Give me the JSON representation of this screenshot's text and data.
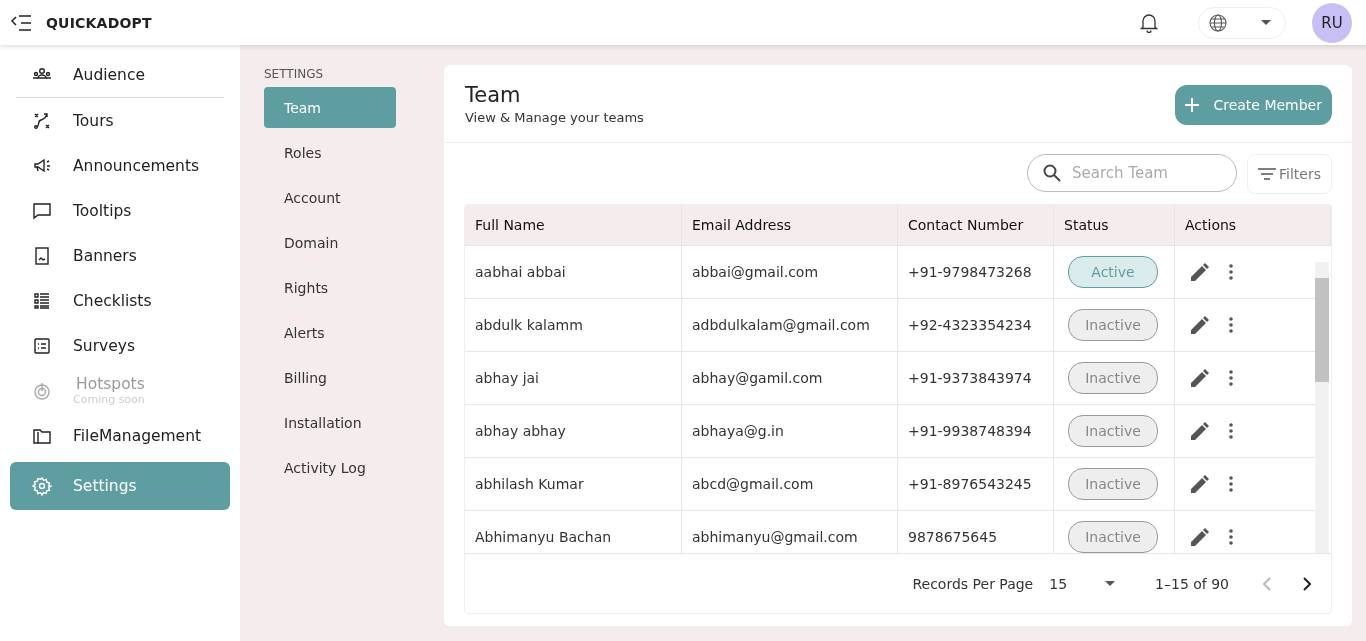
{
  "app": {
    "brand": "QUICKADOPT",
    "avatar": "RU"
  },
  "sidebar": {
    "items": [
      {
        "kind": "audience",
        "label": "Audience",
        "selected": false,
        "disabled": false
      },
      {
        "kind": "tours",
        "label": "Tours",
        "selected": false,
        "disabled": false
      },
      {
        "kind": "announcements",
        "label": "Announcements",
        "selected": false,
        "disabled": false
      },
      {
        "kind": "tooltips",
        "label": "Tooltips",
        "selected": false,
        "disabled": false
      },
      {
        "kind": "banners",
        "label": "Banners",
        "selected": false,
        "disabled": false
      },
      {
        "kind": "checklists",
        "label": "Checklists",
        "selected": false,
        "disabled": false
      },
      {
        "kind": "surveys",
        "label": "Surveys",
        "selected": false,
        "disabled": false
      },
      {
        "kind": "hotspots",
        "label": "Hotspots",
        "note": "Coming soon",
        "selected": false,
        "disabled": true
      },
      {
        "kind": "files",
        "label": "FileManagement",
        "selected": false,
        "disabled": false
      },
      {
        "kind": "settings",
        "label": "Settings",
        "selected": true,
        "disabled": false
      }
    ]
  },
  "settings_nav": {
    "heading": "SETTINGS",
    "items": [
      {
        "label": "Team",
        "selected": true
      },
      {
        "label": "Roles",
        "selected": false
      },
      {
        "label": "Account",
        "selected": false
      },
      {
        "label": "Domain",
        "selected": false
      },
      {
        "label": "Rights",
        "selected": false
      },
      {
        "label": "Alerts",
        "selected": false
      },
      {
        "label": "Billing",
        "selected": false
      },
      {
        "label": "Installation",
        "selected": false
      },
      {
        "label": "Activity Log",
        "selected": false
      }
    ]
  },
  "panel": {
    "title": "Team",
    "subtitle": "View & Manage your teams",
    "create_button": "Create Member",
    "search": {
      "placeholder": "Search Team"
    },
    "filters_button": "Filters"
  },
  "table": {
    "columns": [
      "Full Name",
      "Email Address",
      "Contact Number",
      "Status",
      "Actions"
    ],
    "rows": [
      {
        "name": "aabhai abbai",
        "email": "abbai@gmail.com",
        "contact": "+91-9798473268",
        "status": "Active",
        "active": true
      },
      {
        "name": "abdulk kalamm",
        "email": "adbdulkalam@gmail.com",
        "contact": "+92-4323354234",
        "status": "Inactive",
        "active": false
      },
      {
        "name": "abhay jai",
        "email": "abhay@gamil.com",
        "contact": "+91-9373843974",
        "status": "Inactive",
        "active": false
      },
      {
        "name": "abhay abhay",
        "email": "abhaya@g.in",
        "contact": "+91-9938748394",
        "status": "Inactive",
        "active": false
      },
      {
        "name": "abhilash Kumar",
        "email": "abcd@gmail.com",
        "contact": "+91-8976543245",
        "status": "Inactive",
        "active": false
      },
      {
        "name": "Abhimanyu Bachan",
        "email": "abhimanyu@gmail.com",
        "contact": "9878675645",
        "status": "Inactive",
        "active": false
      }
    ]
  },
  "pagination": {
    "label": "Records Per Page",
    "per_page": "15",
    "range": "1–15 of 90",
    "prev_disabled": true,
    "next_disabled": false
  }
}
